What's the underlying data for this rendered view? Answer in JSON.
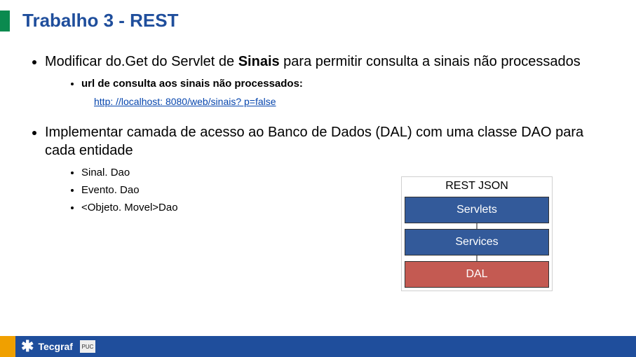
{
  "title": "Trabalho 3 - REST",
  "bullets": {
    "b1_pre": "Modificar do.Get do Servlet de ",
    "b1_bold": "Sinais",
    "b1_post": " para permitir consulta a sinais não processados",
    "b1_sub1": "url de consulta aos sinais não processados:",
    "b1_url": "http: //localhost: 8080/web/sinais? p=false",
    "b2": "Implementar camada de acesso ao Banco de Dados (DAL) com uma classe DAO para cada entidade",
    "b2_sub1": "Sinal. Dao",
    "b2_sub2": "Evento. Dao",
    "b2_sub3": "<Objeto. Movel>Dao"
  },
  "diagram": {
    "top_label": "REST JSON",
    "box1": "Servlets",
    "box2": "Services",
    "box3": "DAL"
  },
  "footer": {
    "brand": "Tecgraf",
    "badge": "PUC"
  }
}
